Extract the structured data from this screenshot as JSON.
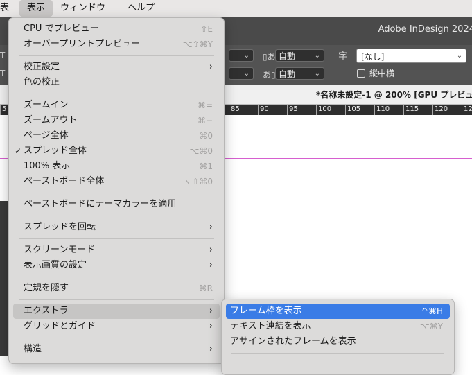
{
  "menubar": {
    "items": [
      "表",
      "表示",
      "ウィンドウ",
      "ヘルプ"
    ]
  },
  "app": {
    "title": "Adobe InDesign 2024"
  },
  "control_panel": {
    "dd1": "自動",
    "dd2": "自動",
    "moji_setting": "[なし]",
    "checkbox_label": "縦中横"
  },
  "document": {
    "tab_title": "*名称未設定-1 @ 200% [GPU プレビュー]",
    "ruler_labels": [
      "5",
      "85",
      "90",
      "95",
      "100",
      "105",
      "110",
      "115",
      "120",
      "12"
    ]
  },
  "view_menu": {
    "items": [
      {
        "label": "CPU でプレビュー",
        "shortcut": "⇧E"
      },
      {
        "label": "オーバープリントプレビュー",
        "shortcut": "⌥⇧⌘Y"
      },
      {
        "label": "校正設定",
        "shortcut": ""
      },
      {
        "label": "色の校正",
        "shortcut": ""
      },
      {
        "label": "ズームイン",
        "shortcut": "⌘="
      },
      {
        "label": "ズームアウト",
        "shortcut": "⌘−"
      },
      {
        "label": "ページ全体",
        "shortcut": "⌘0"
      },
      {
        "label": "スプレッド全体",
        "shortcut": "⌥⌘0"
      },
      {
        "label": "100% 表示",
        "shortcut": "⌘1"
      },
      {
        "label": "ペーストボード全体",
        "shortcut": "⌥⇧⌘0"
      },
      {
        "label": "ペーストボードにテーマカラーを適用",
        "shortcut": ""
      },
      {
        "label": "スプレッドを回転",
        "shortcut": ""
      },
      {
        "label": "スクリーンモード",
        "shortcut": ""
      },
      {
        "label": "表示画質の設定",
        "shortcut": ""
      },
      {
        "label": "定規を隠す",
        "shortcut": "⌘R"
      },
      {
        "label": "エクストラ",
        "shortcut": ""
      },
      {
        "label": "グリッドとガイド",
        "shortcut": ""
      },
      {
        "label": "構造",
        "shortcut": ""
      }
    ]
  },
  "extras_menu": {
    "items": [
      {
        "label": "フレーム枠を表示",
        "shortcut": "^⌘H"
      },
      {
        "label": "テキスト連結を表示",
        "shortcut": "⌥⌘Y"
      },
      {
        "label": "アサインされたフレームを表示",
        "shortcut": ""
      }
    ]
  },
  "colors": {
    "selection": "#3a7ce6",
    "guide": "#d65fcf"
  }
}
